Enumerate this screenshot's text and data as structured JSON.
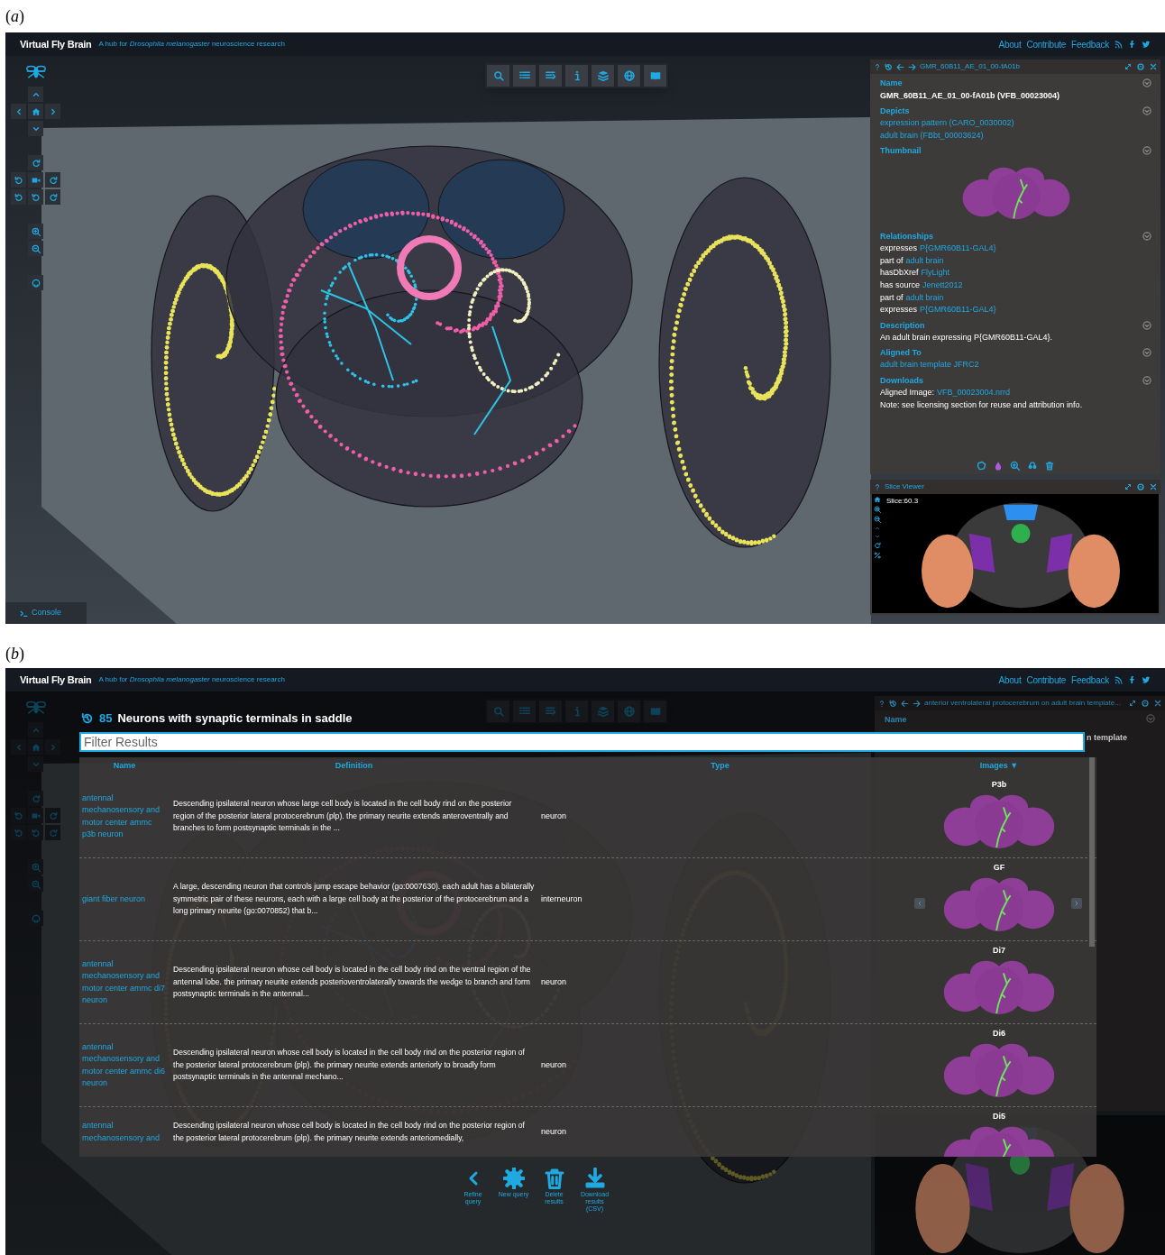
{
  "panel_a": {
    "figure_label": "(*a*)",
    "header": {
      "brand": "Virtual Fly Brain",
      "tagline": "A hub for *Drosophila melanogaster* neuroscience research",
      "links": [
        "About",
        "Contribute",
        "Feedback"
      ]
    },
    "term_info": {
      "title": "GMR_60B11_AE_01_00-fA01b",
      "sections": [
        {
          "kind": "name",
          "heading": "Name",
          "lines": [
            {
              "text": "GMR_60B11_AE_01_00-fA01b (VFB_00023004)"
            }
          ]
        },
        {
          "kind": "list",
          "heading": "Depicts",
          "lines": [
            {
              "link": "expression pattern (CARO_0030002)"
            },
            {
              "link": "adult brain (FBbt_00003624)"
            }
          ]
        },
        {
          "kind": "thumbnail",
          "heading": "Thumbnail"
        },
        {
          "kind": "list",
          "heading": "Relationships",
          "lines": [
            {
              "text": "expresses",
              "link": "P{GMR60B11-GAL4}"
            },
            {
              "text": "part of",
              "link": "adult brain"
            },
            {
              "text": "hasDbXref",
              "link": "FlyLight"
            },
            {
              "text": "has source",
              "link": "Jenett2012"
            },
            {
              "text": "part of",
              "link": "adult brain"
            },
            {
              "text": "expresses",
              "link": "P{GMR60B11-GAL4}"
            }
          ]
        },
        {
          "kind": "list",
          "heading": "Description",
          "lines": [
            {
              "text": "An adult brain expressing P{GMR60B11-GAL4}."
            }
          ]
        },
        {
          "kind": "list",
          "heading": "Aligned To",
          "lines": [
            {
              "link": "adult brain template JFRC2"
            }
          ]
        },
        {
          "kind": "list",
          "heading": "Downloads",
          "lines": [
            {
              "text": "Aligned Image:",
              "link": "VFB_00023004.nrrd"
            },
            {
              "text": "Note: see licensing section for reuse and attribution info."
            }
          ]
        }
      ]
    },
    "slice_viewer": {
      "title": "Slice Viewer",
      "slice": "Slice:60.3"
    },
    "console": "Console"
  },
  "panel_b": {
    "figure_label": "(*b*)",
    "header": {
      "brand": "Virtual Fly Brain",
      "tagline": "A hub for *Drosophila melanogaster* neuroscience research",
      "links": [
        "About",
        "Contribute",
        "Feedback"
      ]
    },
    "background_window": {
      "title": "anterior ventrolateral protocerebrum on adult brain template...",
      "heading": "Name",
      "name_fragment": "n template"
    },
    "query": {
      "count": "85",
      "title": "Neurons with synaptic terminals in saddle"
    },
    "filter": {
      "placeholder": "Filter Results"
    },
    "columns": [
      "Name",
      "Definition",
      "Type",
      "Images ▼"
    ],
    "rows": [
      {
        "name": "antennal mechanosensory and motor center ammc p3b neuron",
        "definition": "Descending ipsilateral neuron whose large cell body is located in the cell body rind on the posterior region of the posterior lateral protocerebrum (plp). the primary neurite extends anteroventrally and branches to form postsynaptic terminals in the ...",
        "type": "neuron",
        "image": "P3b",
        "carousel": false
      },
      {
        "name": "giant fiber neuron",
        "definition": "A large, descending neuron that controls jump escape behavior (go:0007630). each adult has a bilaterally symmetric pair of these neurons, each with a large cell body at the posterior of the protocerebrum and a long primary neurite (go:0070852) that b...",
        "type": "interneuron",
        "image": "GF",
        "carousel": true
      },
      {
        "name": "antennal mechanosensory and motor center ammc di7 neuron",
        "definition": "Descending ipsilateral neuron whose cell body is located in the cell body rind on the ventral region of the antennal lobe. the primary neurite extends posterioventrolaterally towards the wedge to branch and form postsynaptic terminals in the antennal...",
        "type": "neuron",
        "image": "Di7",
        "carousel": false
      },
      {
        "name": "antennal mechanosensory and motor center ammc di6 neuron",
        "definition": "Descending ipsilateral neuron whose cell body is located in the cell body rind on the posterior region of the posterior lateral protocerebrum (plp). the primary neurite extends anteriorly to broadly form postsynaptic terminals in the antennal mechano...",
        "type": "neuron",
        "image": "Di6",
        "carousel": false
      },
      {
        "name": "antennal mechanosensory and",
        "definition": "Descending ipsilateral neuron whose cell body is located in the cell body rind on the posterior region of the posterior lateral protocerebrum (plp). the primary neurite extends anteriomedially,",
        "type": "neuron",
        "image": "Di5",
        "carousel": false
      }
    ],
    "actions": [
      {
        "kind": "back",
        "label": "Refine query"
      },
      {
        "kind": "gear",
        "label": "New query"
      },
      {
        "kind": "trash",
        "label": "Delete results"
      },
      {
        "kind": "download",
        "label": "Download results (CSV)"
      }
    ]
  }
}
